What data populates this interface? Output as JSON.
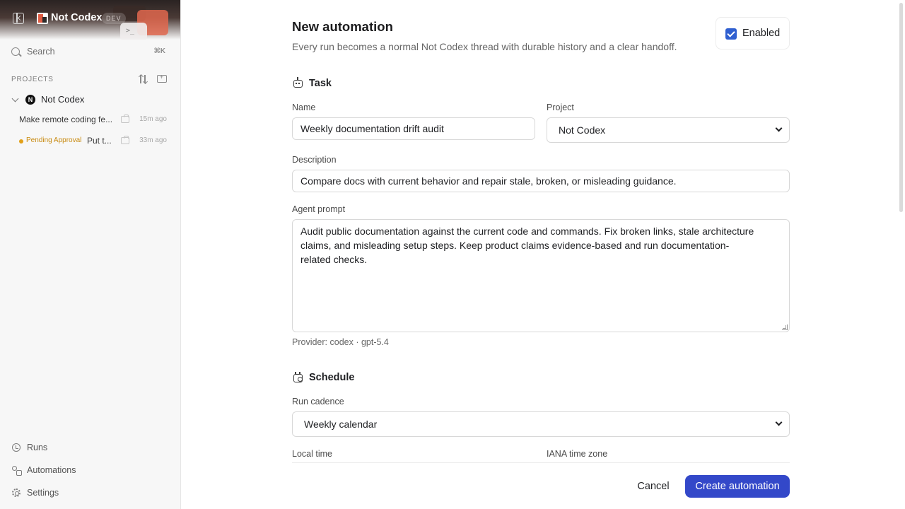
{
  "app": {
    "name": "Not Codex",
    "env_badge": "DEV",
    "header_prompt": ">_"
  },
  "sidebar": {
    "search": {
      "label": "Search",
      "shortcut": "⌘K"
    },
    "projects_label": "PROJECTS",
    "project": {
      "avatar_letter": "N",
      "name": "Not Codex",
      "threads": [
        {
          "title": "Make remote coding fe...",
          "time": "15m ago"
        },
        {
          "status": "Pending Approval",
          "title": "Put t...",
          "time": "33m ago"
        }
      ]
    },
    "nav": [
      {
        "label": "Runs",
        "icon": "history-icon"
      },
      {
        "label": "Automations",
        "icon": "automation-icon"
      },
      {
        "label": "Settings",
        "icon": "gear-icon"
      }
    ]
  },
  "form": {
    "title": "New automation",
    "subtitle": "Every run becomes a normal Not Codex thread with durable history and a clear handoff.",
    "enabled_label": "Enabled",
    "enabled": true,
    "task_section": "Task",
    "name_label": "Name",
    "name_value": "Weekly documentation drift audit",
    "project_label": "Project",
    "project_value": "Not Codex",
    "description_label": "Description",
    "description_value": "Compare docs with current behavior and repair stale, broken, or misleading guidance.",
    "prompt_label": "Agent prompt",
    "prompt_lines": [
      "Audit public documentation against the current code and commands. Fix broken links, stale architecture",
      "claims, and misleading setup steps. Keep product claims evidence-based and run documentation-",
      "related checks."
    ],
    "provider_note": "Provider: codex · gpt-5.4",
    "schedule_section": "Schedule",
    "cadence_label": "Run cadence",
    "cadence_value": "Weekly calendar",
    "local_time_label": "Local time",
    "timezone_label": "IANA time zone",
    "cancel_label": "Cancel",
    "create_label": "Create automation"
  },
  "colors": {
    "accent": "#3348c9",
    "checkbox": "#2f5fd0",
    "pending": "#e2a018"
  }
}
